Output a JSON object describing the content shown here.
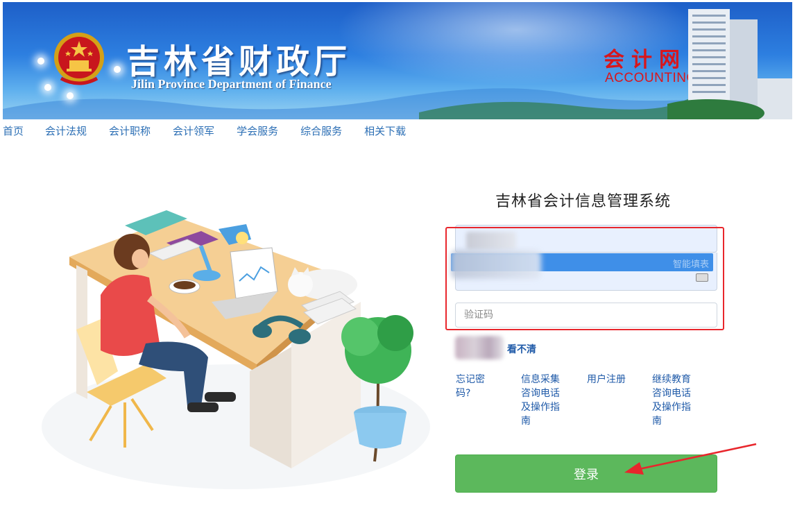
{
  "banner": {
    "title_cn": "吉林省财政厅",
    "title_en": "Jilin Province Department of Finance",
    "site_cn": "会计网",
    "site_en": "ACCOUNTING",
    "brand_red": "#d8161c"
  },
  "nav": {
    "items": [
      "首页",
      "会计法规",
      "会计职称",
      "会计领军",
      "学会服务",
      "综合服务",
      "相关下载"
    ],
    "color": "#2c6fb5"
  },
  "login": {
    "system_title": "吉林省会计信息管理系统",
    "autofill_label": "智能填表",
    "captcha_placeholder": "验证码",
    "captcha_refresh": "看不清",
    "links": [
      "忘记密码?",
      "信息采集咨询电话及操作指南",
      "用户注册",
      "继续教育咨询电话及操作指南"
    ],
    "submit_label": "登录",
    "button_color": "#5cb85c"
  }
}
